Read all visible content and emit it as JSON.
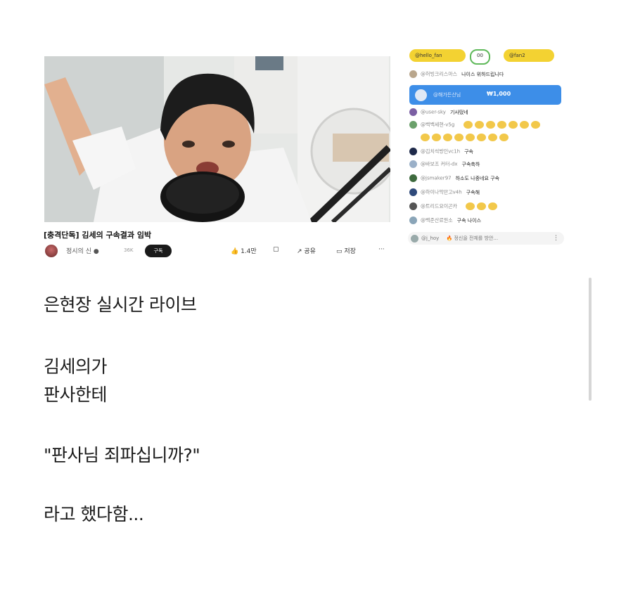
{
  "video": {
    "title": "[충격단독] 김세의 구속결과 임박",
    "channel_name": "정시의 신 ●",
    "subscribers": "36K",
    "subscribe_label": "구독",
    "like_label": "1.4만",
    "share_label": "공유",
    "save_label": "저장",
    "more_label": "···"
  },
  "chat": {
    "top_pills": [
      "@hello_fan",
      "00",
      "@fan2"
    ],
    "messages": [
      {
        "user": "@허빙크리스마스",
        "text": "나이스 위하드립니다"
      },
      {
        "user": "@user-sky",
        "text": "기사떴네"
      },
      {
        "user": "@백백세현-v5g",
        "text": ""
      },
      {
        "user": "@김치석방인vc1h",
        "text": "구속"
      },
      {
        "user": "@바보조 커터-dx",
        "text": "구속축하"
      },
      {
        "user": "@jsmaker97",
        "text": "하소도 나중네요 구속"
      },
      {
        "user": "@하이나막만고v4h",
        "text": "구속해"
      },
      {
        "user": "@트리드요이곤카",
        "text": ""
      },
      {
        "user": "@백준산료원소",
        "text": "구속 나이스"
      }
    ],
    "superchat": {
      "user": "@해가든산님",
      "amount": "₩1,000"
    },
    "input": {
      "user": "@j_hoy",
      "text": "🔥 정신을 전체를 방안..."
    },
    "more_icon": "⋮"
  },
  "post": {
    "lines": [
      "은현장 실시간 라이브",
      "김세의가",
      "판사한테",
      "\"판사님 죄파십니까?\"",
      "라고 했다함..."
    ]
  },
  "colors": {
    "superchat_blue": "#3d8ee8",
    "pill_yellow": "#f3d232",
    "pill_green": "#5fb95a",
    "emoji_yellow": "#f2c84a"
  }
}
